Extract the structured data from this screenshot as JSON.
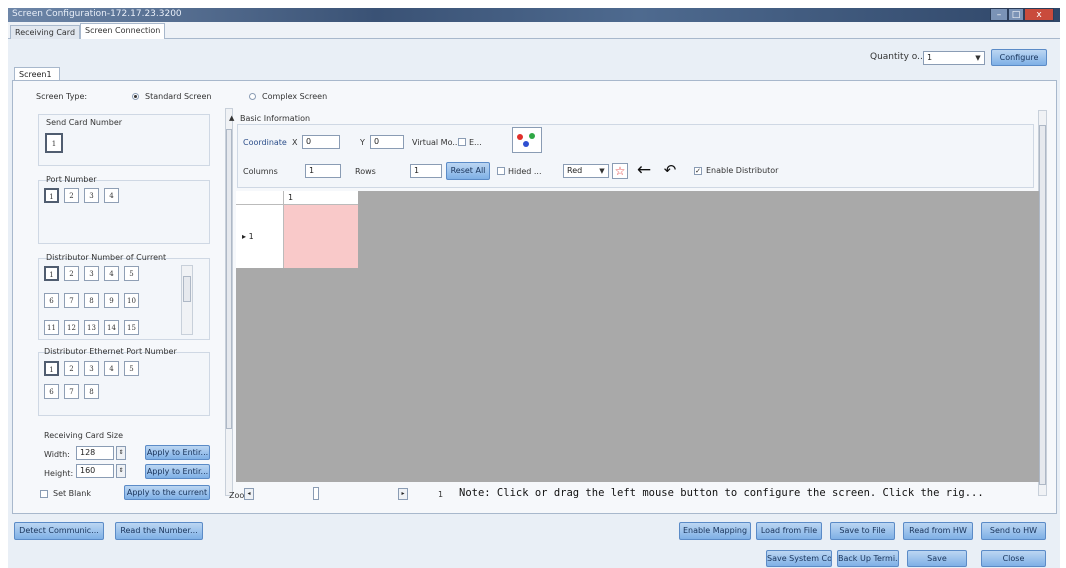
{
  "window": {
    "title": "Screen Configuration-172.17.23.3200",
    "min_label": "–",
    "max_label": "□",
    "close_label": "x"
  },
  "tabs": [
    "Receiving Card",
    "Screen Connection"
  ],
  "top": {
    "quantity_label": "Quantity o...",
    "quantity_value": "1",
    "configure_label": "Configure"
  },
  "screen_tab": "Screen1",
  "screen_type": {
    "label": "Screen Type:",
    "standard": "Standard Screen",
    "complex": "Complex Screen"
  },
  "left": {
    "send_card_title": "Send Card Number",
    "send_card_value": "1",
    "port_title": "Port Number",
    "ports": [
      "1",
      "2",
      "3",
      "4"
    ],
    "distributor_title": "Distributor Number of Current",
    "distributors": [
      "1",
      "2",
      "3",
      "4",
      "5",
      "6",
      "7",
      "8",
      "9",
      "10",
      "11",
      "12",
      "13",
      "14",
      "15"
    ],
    "eth_title": "Distributor Ethernet Port Number",
    "eth_ports": [
      "1",
      "2",
      "3",
      "4",
      "5",
      "6",
      "7",
      "8"
    ],
    "rc_title": "Receiving Card Size",
    "width_label": "Width:",
    "width_value": "128",
    "height_label": "Height:",
    "height_value": "160",
    "apply_entire": "Apply to Entir...",
    "set_blank": "Set Blank",
    "apply_current": "Apply to the current"
  },
  "basic": {
    "title": "Basic Information",
    "coordinate": "Coordinate",
    "x_label": "X",
    "x_value": "0",
    "y_label": "Y",
    "y_value": "0",
    "virtual": "Virtual Mo...",
    "e_label": "E...",
    "columns_label": "Columns",
    "columns_value": "1",
    "rows_label": "Rows",
    "rows_value": "1",
    "reset_all": "Reset All",
    "hidden": "Hided ...",
    "color_value": "Red",
    "enable_distributor": "Enable Distributor"
  },
  "grid": {
    "col_header": "1",
    "row_header": "1"
  },
  "status": {
    "zoom_label": "Zoo",
    "page_value": "1",
    "note": "Note: Click or drag the left mouse button to configure the screen. Click the rig..."
  },
  "bottom": {
    "detect": "Detect Communic...",
    "read_number": "Read the Number...",
    "enable_mapping": "Enable Mapping",
    "load_file": "Load from File",
    "save_file": "Save to File",
    "read_hw": "Read from HW",
    "send_hw": "Send to HW",
    "save_system": "Save System Co...",
    "backup": "Back Up Termi...",
    "save": "Save",
    "close": "Close"
  },
  "colors": {
    "accent": "#7fb0e6",
    "grid_bg": "#a9a9a9",
    "cell_pink": "#f9c9c9"
  }
}
